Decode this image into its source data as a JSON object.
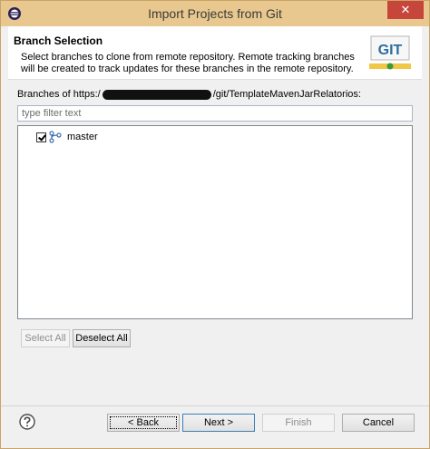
{
  "window": {
    "title": "Import Projects from Git",
    "close_glyph": "✕"
  },
  "banner": {
    "title": "Branch Selection",
    "description": "Select branches to clone from remote repository. Remote tracking branches will be created to track updates for these branches in the remote repository.",
    "logo_text": "GIT"
  },
  "branches": {
    "label_prefix": "Branches of https:/",
    "label_suffix": "/git/TemplateMavenJarRelatorios:",
    "filter_placeholder": "type filter text",
    "items": [
      {
        "name": "master",
        "checked": true
      }
    ]
  },
  "buttons": {
    "select_all": "Select All",
    "deselect_all": "Deselect All",
    "back": "< Back",
    "next": "Next >",
    "finish": "Finish",
    "cancel": "Cancel"
  },
  "colors": {
    "titlebar": "#e9c88f",
    "close": "#c7463c",
    "git_logo": "#2c6e9f"
  },
  "icons": {
    "app": "eclipse-icon",
    "branch": "branch-icon",
    "help": "help-icon"
  }
}
